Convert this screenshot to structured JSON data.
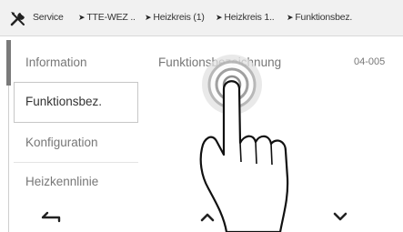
{
  "breadcrumb": {
    "items": [
      {
        "label": "Service"
      },
      {
        "label": "TTE-WEZ .."
      },
      {
        "label": "Heizkreis (1)"
      },
      {
        "label": "Heizkreis 1.."
      },
      {
        "label": "Funktionsbez."
      }
    ]
  },
  "menu": {
    "items": [
      {
        "label": "Information"
      },
      {
        "label": "Funktionsbez."
      },
      {
        "label": "Konfiguration"
      },
      {
        "label": "Heizkennlinie"
      }
    ],
    "selected": "Funktionsbez."
  },
  "content": {
    "title": "Funktionsbezeichnung",
    "code": "04-005"
  },
  "nav": {
    "back_icon": "back-arrow-icon",
    "up_icon": "chevron-up-icon",
    "down_icon": "chevron-down-icon"
  },
  "colors": {
    "topbar": "#f1f1f1",
    "accent": "#7a7a7a",
    "text": "#777777"
  }
}
